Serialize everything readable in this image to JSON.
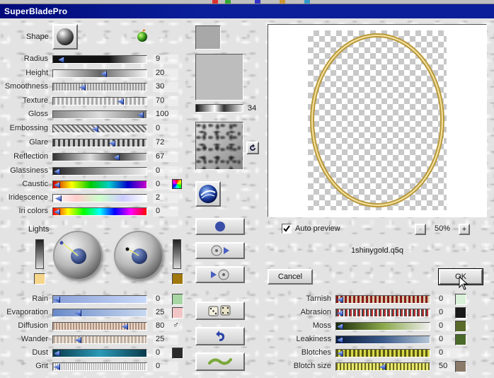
{
  "window": {
    "title": "SuperBladePro"
  },
  "shape": {
    "label": "Shape"
  },
  "top_sliders": [
    {
      "key": "radius",
      "label": "Radius",
      "value": "9",
      "level": 0.05
    },
    {
      "key": "height",
      "label": "Height",
      "value": "20",
      "level": 0.55
    },
    {
      "key": "smoothness",
      "label": "Smoothness",
      "value": "30",
      "level": 0.3
    },
    {
      "key": "texture",
      "label": "Texture",
      "value": "70",
      "level": 0.75
    },
    {
      "key": "gloss",
      "label": "Gloss",
      "value": "100",
      "level": 0.98
    },
    {
      "key": "embossing",
      "label": "Embossing",
      "value": "0",
      "level": 0.45
    },
    {
      "key": "glare",
      "label": "Glare",
      "value": "72",
      "level": 0.65
    },
    {
      "key": "reflection",
      "label": "Reflection",
      "value": "67",
      "level": 0.7
    },
    {
      "key": "glassiness",
      "label": "Glassiness",
      "value": "0",
      "level": 0.0
    },
    {
      "key": "caustic",
      "label": "Caustic",
      "value": "0",
      "level": 0.0
    },
    {
      "key": "iridescence",
      "label": "Iridescence",
      "value": "2",
      "level": 0.02
    },
    {
      "key": "iri-colors",
      "label": "Iri colors",
      "value": "0",
      "level": 0.0
    }
  ],
  "texture_scale": {
    "value": "34"
  },
  "lights": {
    "label": "Lights"
  },
  "bottom_sliders": [
    {
      "key": "rain",
      "label": "Rain",
      "value": "0",
      "level": 0.0
    },
    {
      "key": "evaporation",
      "label": "Evaporation",
      "value": "25",
      "level": 0.25
    },
    {
      "key": "diffusion",
      "label": "Diffusion",
      "value": "80",
      "level": 0.8
    },
    {
      "key": "wander",
      "label": "Wander",
      "value": "25",
      "level": 0.25
    },
    {
      "key": "dust",
      "label": "Dust",
      "value": "0",
      "level": 0.0
    },
    {
      "key": "grit",
      "label": "Grit",
      "value": "0",
      "level": 0.0
    }
  ],
  "right_sliders": [
    {
      "key": "tarnish",
      "label": "Tarnish",
      "value": "0",
      "level": 0.0
    },
    {
      "key": "abrasion",
      "label": "Abrasion",
      "value": "0",
      "level": 0.0
    },
    {
      "key": "moss",
      "label": "Moss",
      "value": "0",
      "level": 0.0
    },
    {
      "key": "leakiness",
      "label": "Leakiness",
      "value": "0",
      "level": 0.0
    },
    {
      "key": "blotches",
      "label": "Blotches",
      "value": "0",
      "level": 0.0
    },
    {
      "key": "blotch-size",
      "label": "Blotch size",
      "value": "50",
      "level": 0.5
    }
  ],
  "preview": {
    "auto_preview_label": "Auto preview",
    "auto_preview_checked": true,
    "zoom": "50%",
    "zoom_in_label": "+",
    "zoom_out_label": "-",
    "filename": "1shinygold.q5q"
  },
  "buttons": {
    "cancel": "Cancel",
    "ok": "OK"
  },
  "colors": {
    "title_bar": "#0b1f9a",
    "light_left_swatch": "#f5d58a",
    "light_right_swatch": "#a0780e",
    "rain_swatch": "#a7d5a3",
    "evaporation_swatch": "#f2c6c6",
    "dust_swatch": "#2a2a2a",
    "tarnish_swatch": "#d8f0d8",
    "abrasion_swatch": "#1a1a1a",
    "moss_swatch": "#5a6a2a",
    "leakiness_swatch": "#4a6a2a",
    "blotch_size_swatch": "#8a7a6a",
    "frame_gold": "#d4b560"
  },
  "icons": {
    "shape": "sphere-icon",
    "apple": "apple-icon",
    "refresh": "refresh-icon",
    "swirl": "blue-swirl-icon",
    "sphere_button": "sphere-button-icon",
    "cd_forward": "cd-forward-icon",
    "cd_back": "cd-back-icon",
    "dice": "dice-icon",
    "undo": "undo-arrow-icon",
    "wave": "wave-icon"
  }
}
